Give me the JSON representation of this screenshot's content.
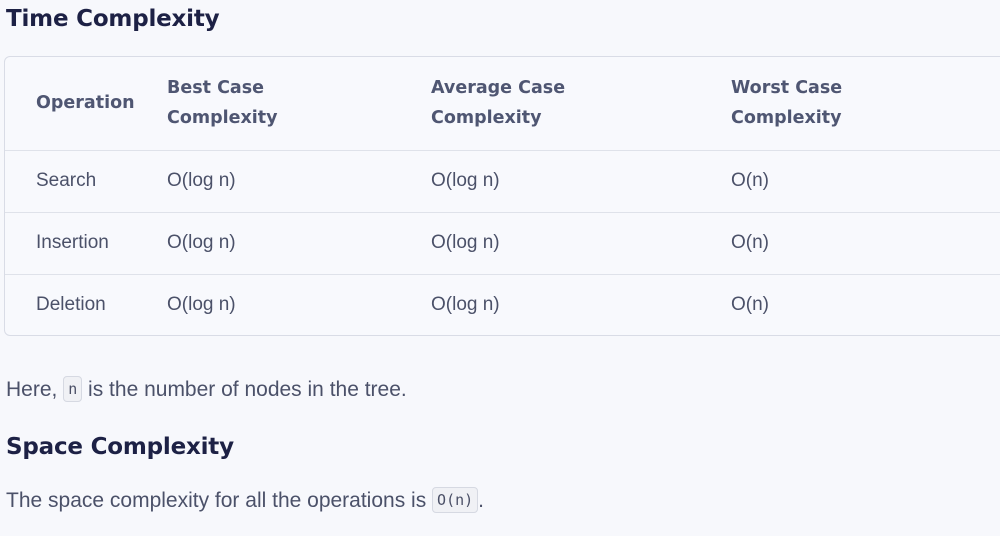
{
  "time_complexity": {
    "title": "Time Complexity",
    "headers": {
      "operation": "Operation",
      "best_line1": "Best Case",
      "best_line2": "Complexity",
      "avg_line1": "Average Case",
      "avg_line2": "Complexity",
      "worst_line1": "Worst Case",
      "worst_line2": "Complexity"
    },
    "rows": [
      {
        "operation": "Search",
        "best": "O(log n)",
        "average": "O(log n)",
        "worst": "O(n)"
      },
      {
        "operation": "Insertion",
        "best": "O(log n)",
        "average": "O(log n)",
        "worst": "O(n)"
      },
      {
        "operation": "Deletion",
        "best": "O(log n)",
        "average": "O(log n)",
        "worst": "O(n)"
      }
    ]
  },
  "note": {
    "prefix": "Here, ",
    "code": "n",
    "suffix": " is the number of nodes in the tree."
  },
  "space_complexity": {
    "title": "Space Complexity",
    "prefix": "The space complexity for all the operations is ",
    "code": "O(n)",
    "suffix": "."
  }
}
